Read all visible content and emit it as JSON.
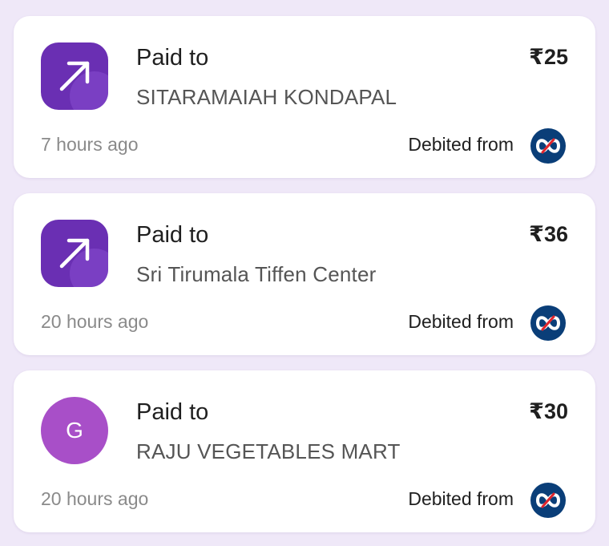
{
  "transactions": [
    {
      "title": "Paid to",
      "payee": "SITARAMAIAH KONDAPAL",
      "amount": "₹25",
      "time": "7 hours ago",
      "debited_label": "Debited from",
      "icon": "arrow-up-right-icon"
    },
    {
      "title": "Paid to",
      "payee": "Sri Tirumala Tiffen Center",
      "amount": "₹36",
      "time": "20 hours ago",
      "debited_label": "Debited from",
      "icon": "arrow-up-right-icon"
    },
    {
      "title": "Paid to",
      "payee": "RAJU VEGETABLES MART",
      "amount": "₹30",
      "time": "20 hours ago",
      "debited_label": "Debited from",
      "avatar_letter": "G"
    }
  ],
  "colors": {
    "background": "#efe8f8",
    "icon_purple": "#6a2fb3",
    "avatar_purple": "#a84fc8",
    "bank_logo_blue": "#0a3e78",
    "bank_logo_red": "#e0242b"
  },
  "bank_logo_icon": "kotak-bank-logo-icon"
}
